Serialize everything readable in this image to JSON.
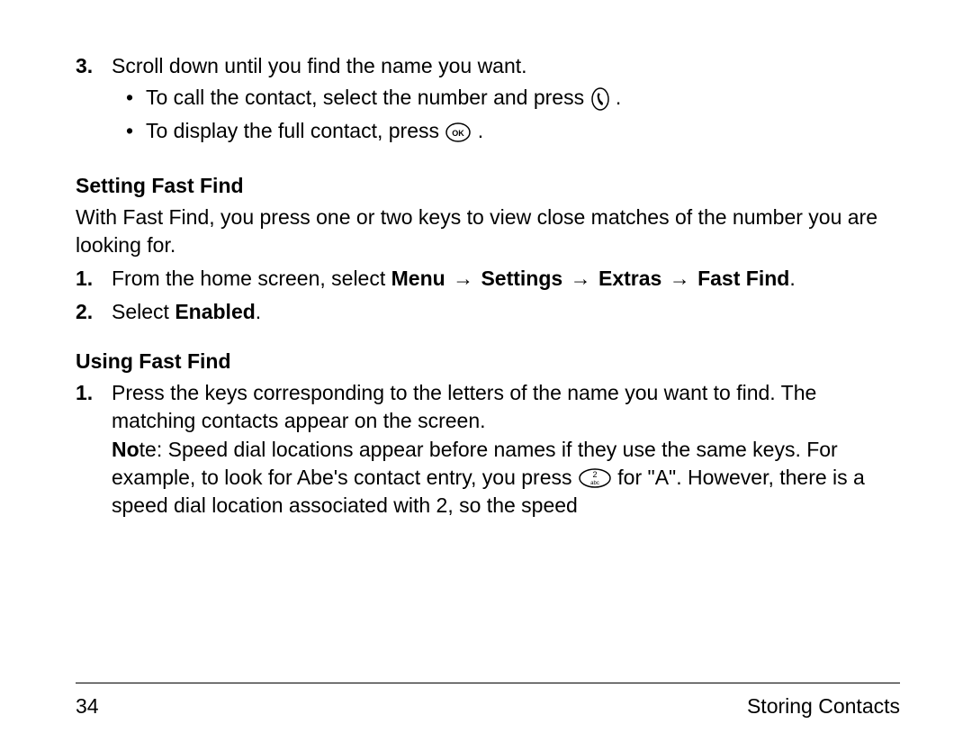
{
  "step3": {
    "num": "3.",
    "text": "Scroll down until you find the name you want.",
    "bullets": [
      {
        "before": "To call the contact, select the number and press ",
        "after": "."
      },
      {
        "before": "To display the full contact, press ",
        "after": "."
      }
    ]
  },
  "section_setting": {
    "heading": "Setting Fast Find",
    "para": "With Fast Find, you press one or two keys to view close matches of the number you are looking for.",
    "step1": {
      "num": "1.",
      "lead": "From the home screen, select ",
      "menu": "Menu",
      "arrow": " → ",
      "settings": "Settings",
      "extras": "Extras",
      "fastfind": "Fast Find",
      "trail": "."
    },
    "step2": {
      "num": "2.",
      "lead": "Select ",
      "enabled": "Enabled",
      "trail": "."
    }
  },
  "section_using": {
    "heading": "Using Fast Find",
    "step1": {
      "num": "1.",
      "line1": "Press the keys corresponding to the letters of the name you want to find. The matching contacts appear on the screen.",
      "note_bold": "No",
      "note_rest": "te: Speed dial locations appear before names if they use the same keys. For example, to look for Abe's contact entry, you press ",
      "note_after_icon": " for \"A\". However, there is a speed dial location associated with 2, so the speed"
    }
  },
  "footer": {
    "page": "34",
    "section": "Storing Contacts"
  }
}
